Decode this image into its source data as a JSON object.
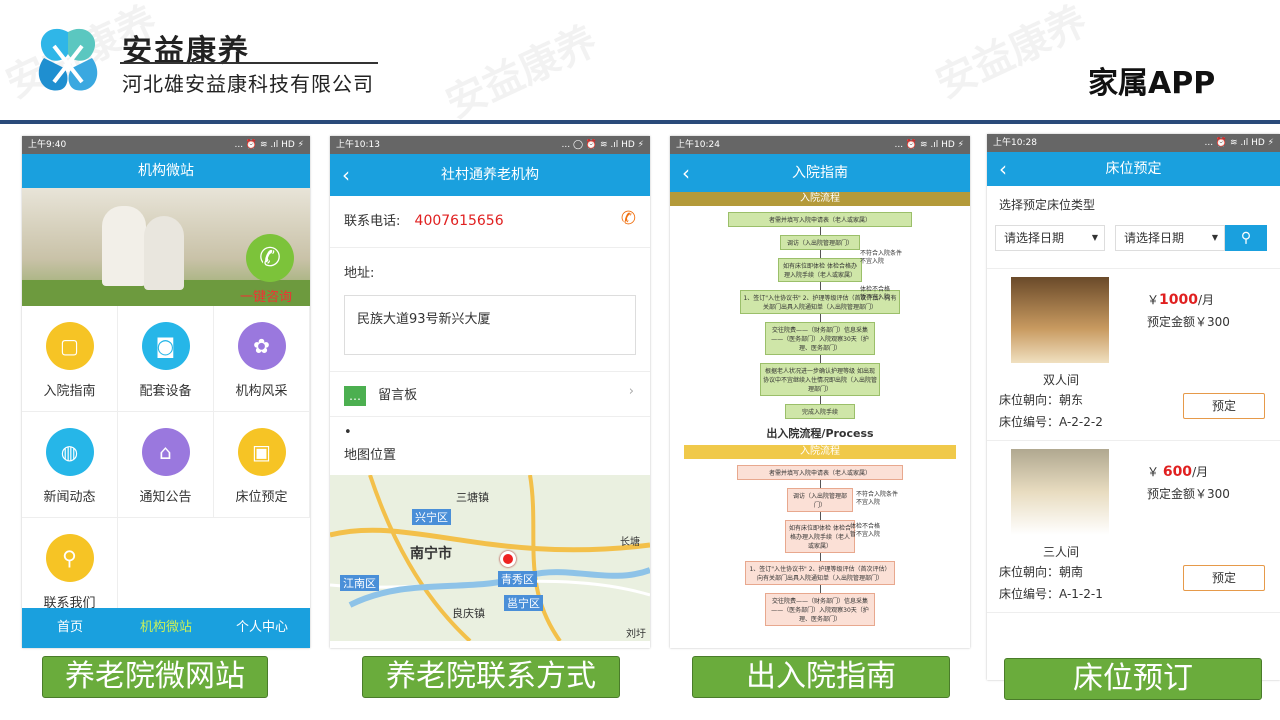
{
  "header": {
    "brand": "安益康养",
    "company": "河北雄安益康科技有限公司",
    "title": "家属APP",
    "watermark": "安益康养"
  },
  "phone1": {
    "time": "上午9:40",
    "status": "... ⏰ ≋ .ıl HD ⚡",
    "title": "机构微站",
    "consult": "一键咨询",
    "grid": [
      "入院指南",
      "配套设备",
      "机构风采",
      "新闻动态",
      "通知公告",
      "床位预定",
      "联系我们"
    ],
    "tabs": [
      "首页",
      "机构微站",
      "个人中心"
    ]
  },
  "phone2": {
    "time": "上午10:13",
    "status": "... ◯ ⏰ ≋ .ıl HD ⚡",
    "title": "社村通养老机构",
    "phone_label": "联系电话:",
    "phone": "4007615656",
    "addr_label": "地址:",
    "addr": "民族大道93号新兴大厦",
    "board": "留言板",
    "bullet": "•",
    "map_label": "地图位置",
    "map": {
      "sanluo": "三塘镇",
      "xingning": "兴宁区",
      "nanning": "南宁市",
      "qingxiu": "青秀区",
      "jiangnan": "江南区",
      "yongning": "邕宁区",
      "liangqing": "良庆镇",
      "changtang": "长塘",
      "liuxu": "刘圩"
    }
  },
  "phone3": {
    "time": "上午10:24",
    "status": "... ⏰ ≋ .ıl HD ⚡",
    "title": "入院指南",
    "section1": "入院流程",
    "process_title": "出入院流程/Process",
    "section2": "入院流程",
    "steps": [
      "者需并填写入院申请表（老人或家属）",
      "调访（入出院管理部门）",
      "如有床位即体检 体检合格办理入院手续（老人或家属）",
      "1、签订\"入住协议书\" 2、护理等级评估（首次评估）向有关部门出具入院通知单（入出院管理部门）",
      "交往院费——（财务部门）信息采集——（医务部门）入院观察30天（护理、医务部门）",
      "根据老人状况进一步确认护理等级 如出现协议中不宜继续入住情况即出院（入出院管理部门）",
      "完成入院手续"
    ],
    "side": [
      {
        "a": "不符合入院条件",
        "b": "不宜入院"
      },
      {
        "a": "体检不合格",
        "b": "暂不宜入院"
      }
    ]
  },
  "phone4": {
    "time": "上午10:28",
    "status": "... ⏰ ≋ .ıl HD ⚡",
    "title": "床位预定",
    "subtitle": "选择预定床位类型",
    "date1": "请选择日期",
    "date2": "请选择日期",
    "beds": [
      {
        "price_prefix": "￥",
        "price": "1000",
        "unit": "/月",
        "deposit": "预定金额￥300",
        "type": "双人间",
        "orient": "床位朝向：朝东",
        "code": "床位编号：A-2-2-2",
        "btn": "预定"
      },
      {
        "price_prefix": "￥ ",
        "price": "600",
        "unit": "/月",
        "deposit": "预定金额￥300",
        "type": "三人间",
        "orient": "床位朝向：朝南",
        "code": "床位编号：A-1-2-1",
        "btn": "预定"
      }
    ]
  },
  "captions": [
    "养老院微网站",
    "养老院联系方式",
    "出入院指南",
    "床位预订"
  ]
}
